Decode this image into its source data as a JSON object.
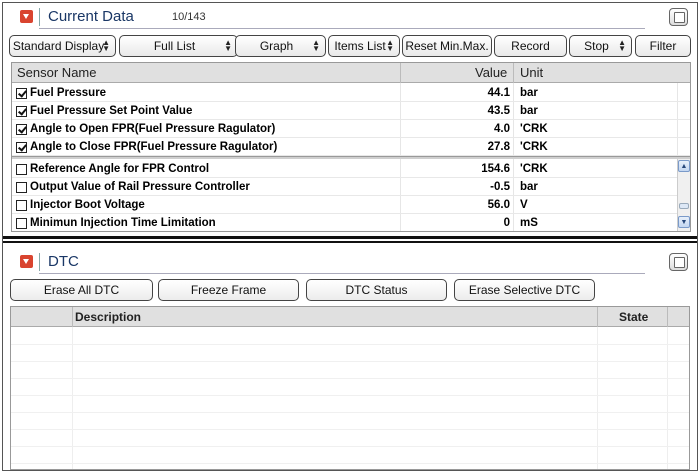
{
  "current_data": {
    "title": "Current Data",
    "count": "10/143",
    "toolbar": {
      "display_mode": "Standard Display",
      "list_mode": "Full List",
      "graph": "Graph",
      "items_list": "Items List",
      "reset_min_max": "Reset Min.Max.",
      "record": "Record",
      "stop": "Stop",
      "filter": "Filter"
    },
    "columns": {
      "sensor_name": "Sensor Name",
      "value": "Value",
      "unit": "Unit"
    },
    "fixed_rows": [
      {
        "name": "Fuel Pressure",
        "value": "44.1",
        "unit": "bar",
        "checked": true
      },
      {
        "name": "Fuel Pressure Set Point Value",
        "value": "43.5",
        "unit": "bar",
        "checked": true
      },
      {
        "name": "Angle to Open FPR(Fuel Pressure Ragulator)",
        "value": "4.0",
        "unit": "'CRK",
        "checked": true
      },
      {
        "name": "Angle to Close FPR(Fuel Pressure Ragulator)",
        "value": "27.8",
        "unit": "'CRK",
        "checked": true
      }
    ],
    "scroll_rows": [
      {
        "name": "Reference Angle for FPR Control",
        "value": "154.6",
        "unit": "'CRK",
        "checked": false
      },
      {
        "name": "Output Value of Rail Pressure Controller",
        "value": "-0.5",
        "unit": "bar",
        "checked": false
      },
      {
        "name": "Injector Boot Voltage",
        "value": "56.0",
        "unit": "V",
        "checked": false
      },
      {
        "name": "Minimun Injection Time Limitation",
        "value": "0",
        "unit": "mS",
        "checked": false
      }
    ]
  },
  "dtc": {
    "title": "DTC",
    "buttons": {
      "erase_all": "Erase All DTC",
      "freeze_frame": "Freeze Frame",
      "dtc_status": "DTC Status",
      "erase_selective": "Erase Selective DTC"
    },
    "columns": {
      "description": "Description",
      "state": "State"
    }
  },
  "colors": {
    "accent_red": "#d9442f",
    "title_blue": "#1a3766",
    "header_gray": "#e0e0e0"
  }
}
